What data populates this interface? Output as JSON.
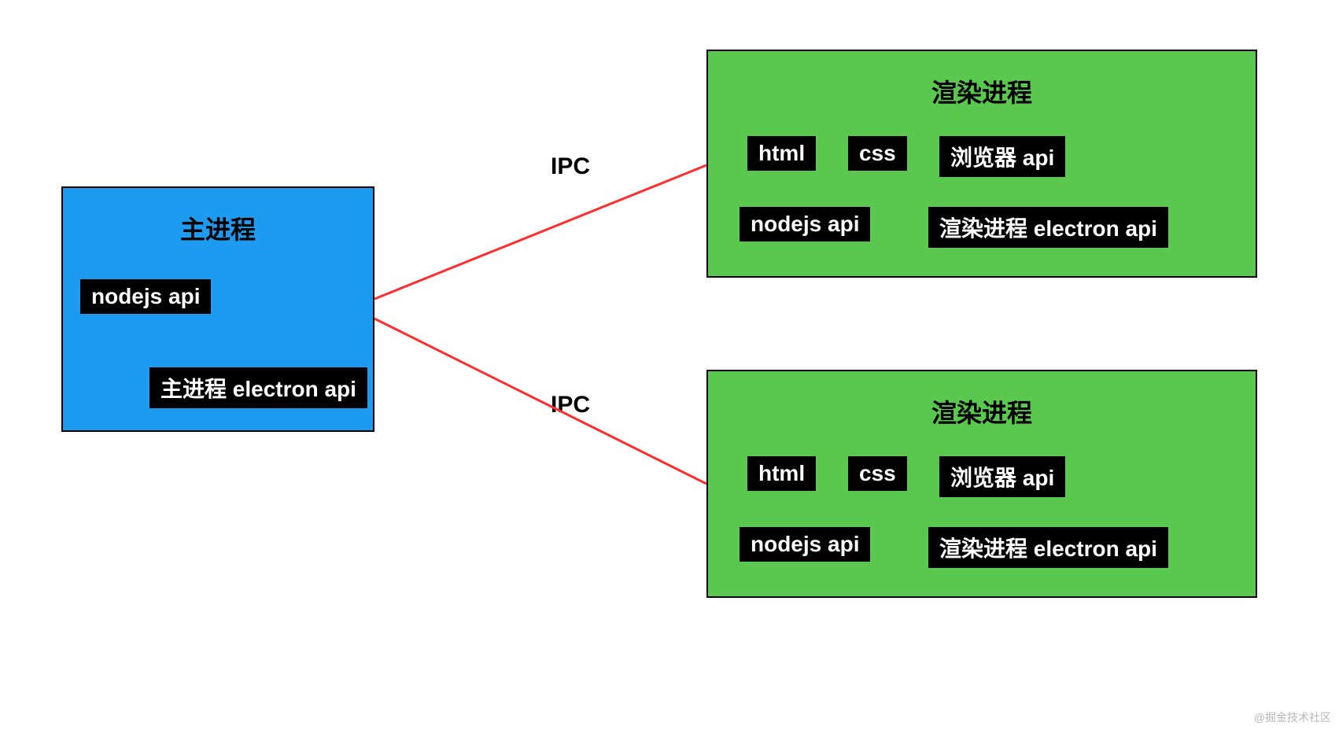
{
  "main_process": {
    "title": "主进程",
    "tags": {
      "nodejs": "nodejs  api",
      "electron": "主进程 electron api"
    }
  },
  "render_process_1": {
    "title": "渲染进程",
    "tags": {
      "html": "html",
      "css": "css",
      "browser": "浏览器 api",
      "nodejs": "nodejs  api",
      "electron": "渲染进程 electron api"
    }
  },
  "render_process_2": {
    "title": "渲染进程",
    "tags": {
      "html": "html",
      "css": "css",
      "browser": "浏览器 api",
      "nodejs": "nodejs  api",
      "electron": "渲染进程 electron api"
    }
  },
  "connectors": {
    "ipc1": "IPC",
    "ipc2": "IPC"
  },
  "watermark": "@掘金技术社区"
}
